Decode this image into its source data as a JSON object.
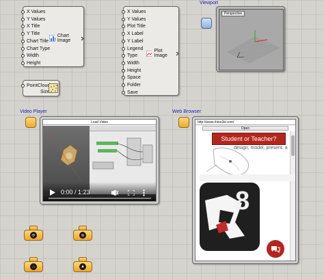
{
  "chart_component": {
    "inputs": [
      "X Values",
      "Y Values",
      "X Title",
      "Y Title",
      "Chart Title",
      "Chart Type",
      "Width",
      "Height"
    ],
    "output": "Chart Image"
  },
  "plot_component": {
    "inputs": [
      "X Values",
      "Y Values",
      "Plot Title",
      "X Label",
      "Y Label",
      "Legend",
      "Type",
      "Width",
      "Height",
      "Space",
      "Folder",
      "Save"
    ],
    "output": "Plot Image"
  },
  "viewport": {
    "title": "Viewport",
    "view_name": "Perspective"
  },
  "pointcloud": {
    "input": "PointCloud",
    "output": "Size"
  },
  "video_player": {
    "title": "Video Player",
    "inner_title": "Load Video",
    "time": "0:00 / 1:23"
  },
  "web_browser": {
    "title": "Web Browser",
    "url": "http://www.rhino3d.com/",
    "open_label": "Open",
    "banner": "Student or Teacher?",
    "tagline": "design, model, present, a",
    "logo_number": "8"
  },
  "colors": {
    "canvas": "#d5d3ce",
    "component": "#eceae6",
    "title_blue": "#1a1fb3",
    "banner_red": "#b3261e",
    "yellow": "#f1a92a"
  }
}
